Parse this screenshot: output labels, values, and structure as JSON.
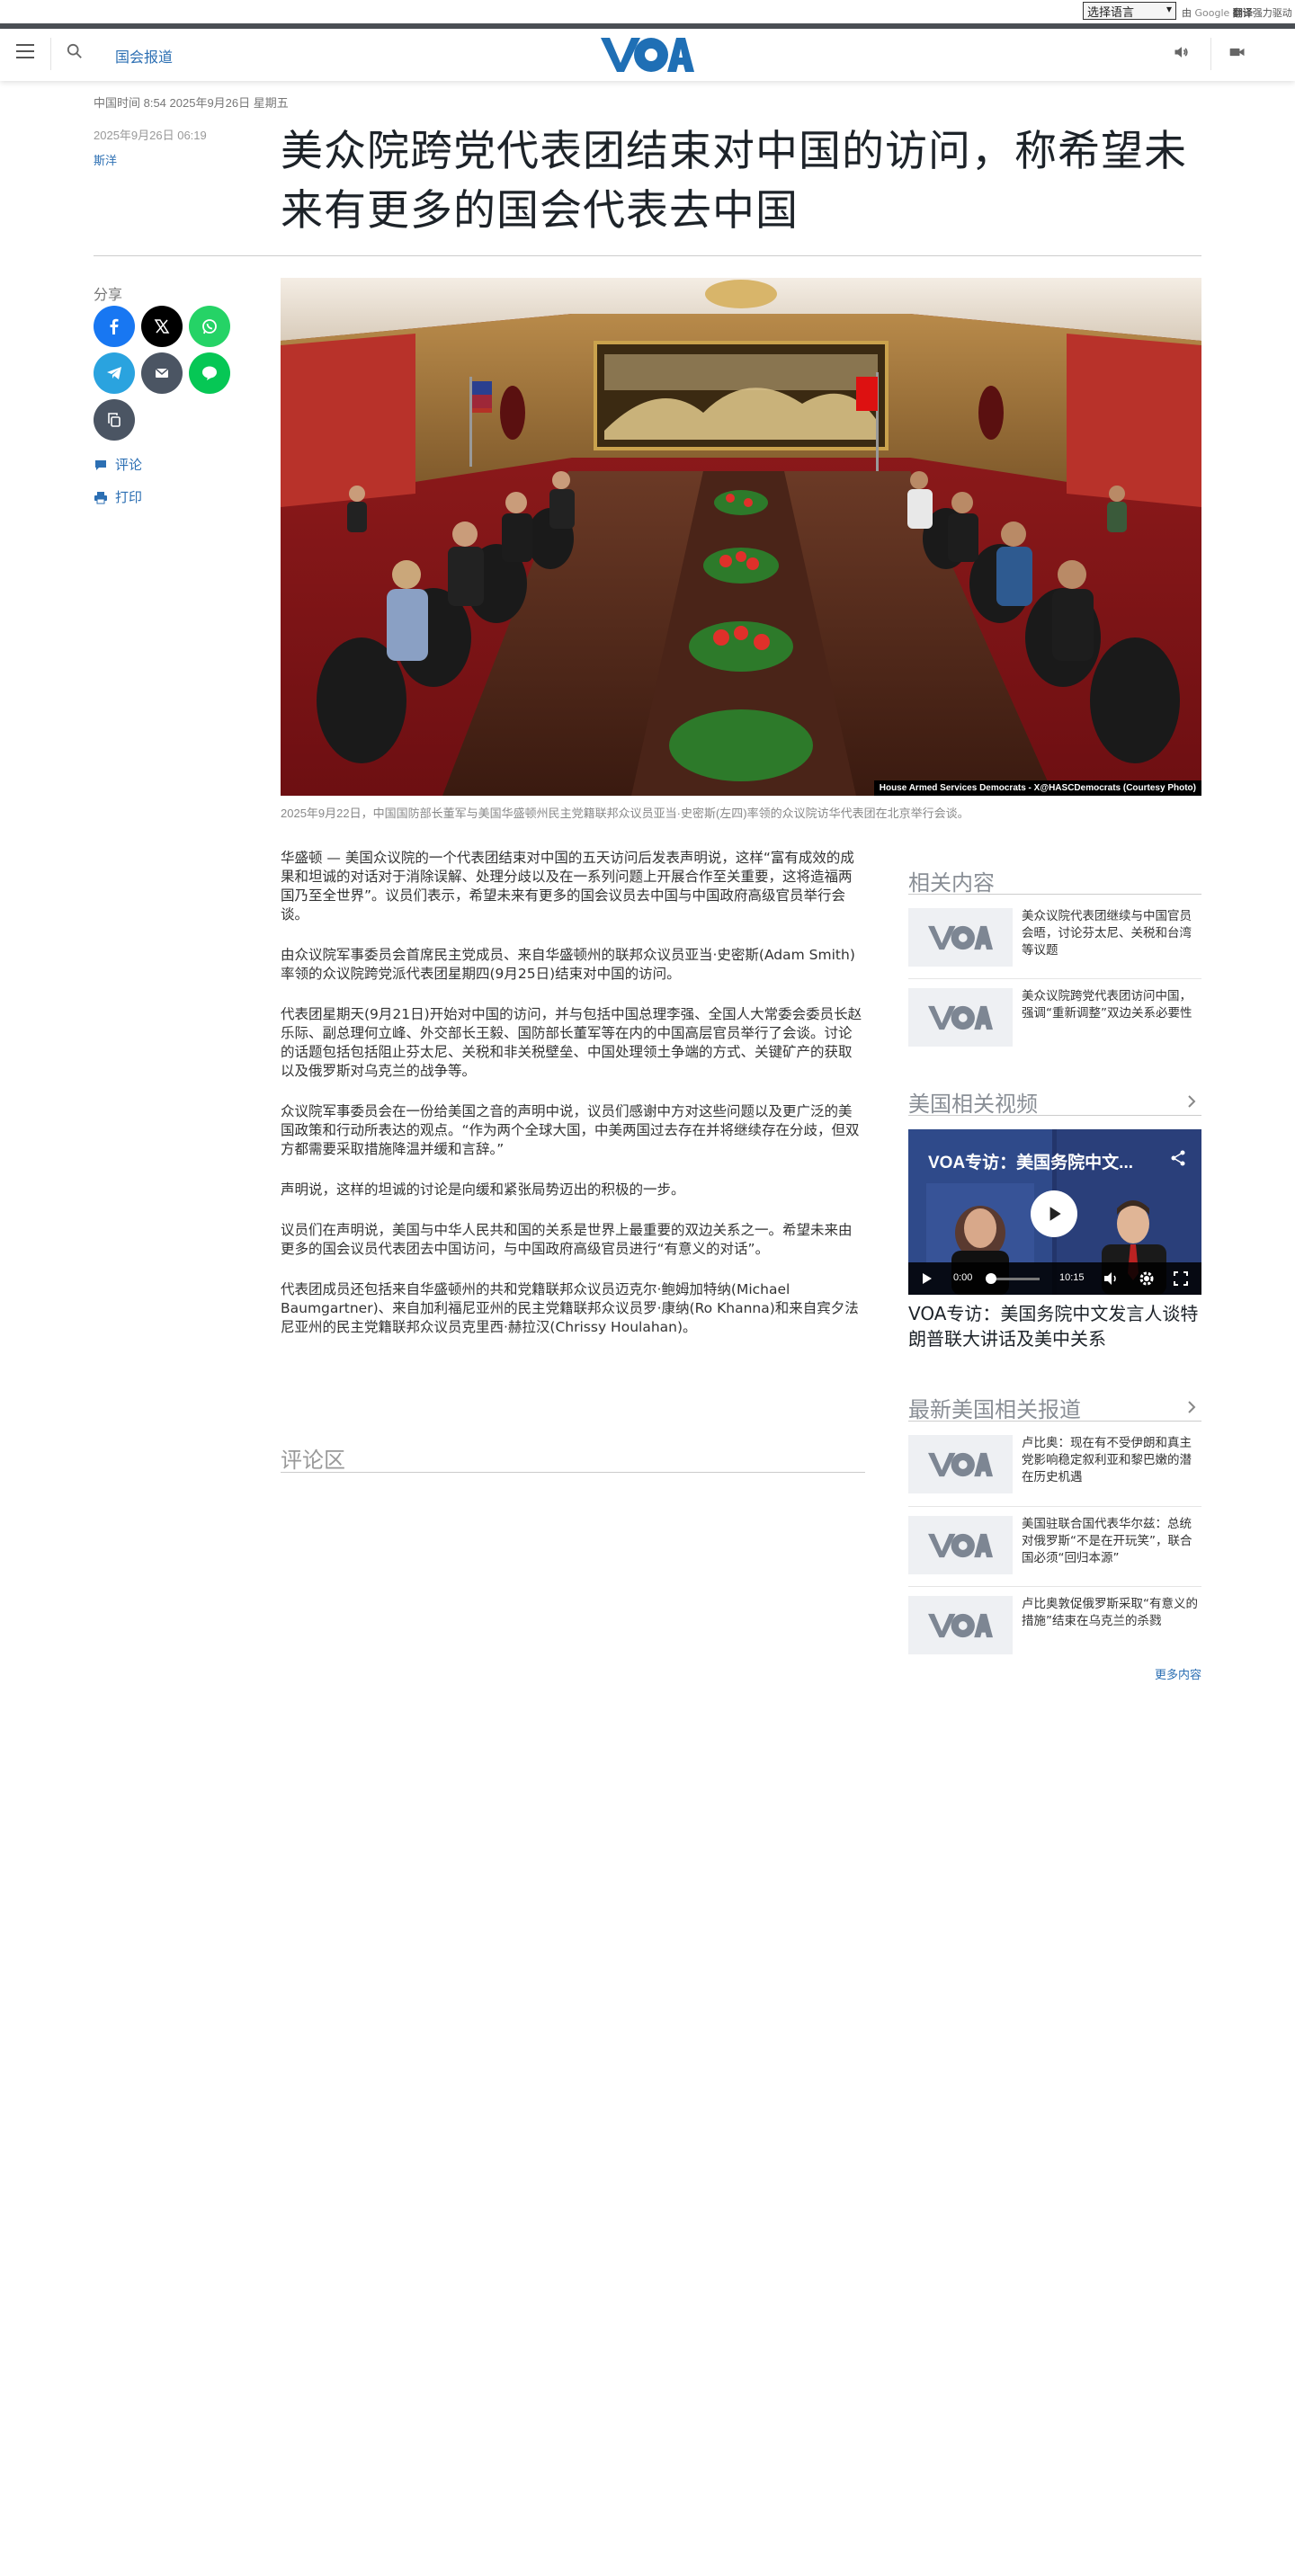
{
  "translate_bar": {
    "select_value": "选择语言",
    "credit_by": "由",
    "credit_google": "Google",
    "credit_translate": "翻译",
    "credit_suffix": "强力驱动"
  },
  "header": {
    "section_link": "国会报道",
    "logo_alt": "VOA",
    "icons": [
      "menu-icon",
      "search-icon",
      "speaker-icon",
      "video-camera-icon"
    ]
  },
  "dateline": "中国时间 8:54 2025年9月26日 星期五",
  "meta": {
    "date": "2025年9月26日 06:19",
    "author": "斯洋"
  },
  "headline": "美众院跨党代表团结束对中国的访问，称希望未来有更多的国会代表去中国",
  "share": {
    "label": "分享",
    "buttons": [
      {
        "name": "facebook",
        "color": "#1877f2"
      },
      {
        "name": "x",
        "color": "#000000"
      },
      {
        "name": "whatsapp",
        "color": "#25d366"
      },
      {
        "name": "telegram",
        "color": "#2aa3df"
      },
      {
        "name": "email",
        "color": "#4b5563"
      },
      {
        "name": "line",
        "color": "#06c755"
      },
      {
        "name": "copy-link",
        "color": "#4b5563"
      }
    ],
    "comment_label": "评论",
    "print_label": "打印"
  },
  "photo": {
    "credit": "House Armed Services Democrats - X@HASCDemocrats (Courtesy Photo)",
    "caption": "2025年9月22日，中国国防部长董军与美国华盛顿州民主党籍联邦众议员亚当·史密斯(左四)率领的众议院访华代表团在北京举行会谈。"
  },
  "article": {
    "paragraphs": [
      "华盛顿 — 美国众议院的一个代表团结束对中国的五天访问后发表声明说，这样“富有成效的成果和坦诚的对话对于消除误解、处理分歧以及在一系列问题上开展合作至关重要，这将造福两国乃至全世界”。议员们表示，希望未来有更多的国会议员去中国与中国政府高级官员举行会谈。",
      "由众议院军事委员会首席民主党成员、来自华盛顿州的联邦众议员亚当·史密斯(Adam Smith)率领的众议院跨党派代表团星期四(9月25日)结束对中国的访问。",
      "代表团星期天(9月21日)开始对中国的访问，并与包括中国总理李强、全国人大常委会委员长赵乐际、副总理何立峰、外交部长王毅、国防部长董军等在内的中国高层官员举行了会谈。讨论的话题包括包括阻止芬太尼、关税和非关税壁垒、中国处理领土争端的方式、关键矿产的获取以及俄罗斯对乌克兰的战争等。",
      "众议院军事委员会在一份给美国之音的声明中说，议员们感谢中方对这些问题以及更广泛的美国政策和行动所表达的观点。“作为两个全球大国，中美两国过去存在并将继续存在分歧，但双方都需要采取措施降温并缓和言辞。”",
      "声明说，这样的坦诚的讨论是向缓和紧张局势迈出的积极的一步。",
      "议员们在声明说，美国与中华人民共和国的关系是世界上最重要的双边关系之一。希望未来由更多的国会议员代表团去中国访问，与中国政府高级官员进行“有意义的对话”。",
      "代表团成员还包括来自华盛顿州的共和党籍联邦众议员迈克尔·鲍姆加特纳(Michael Baumgartner)、来自加利福尼亚州的民主党籍联邦众议员罗·康纳(Ro Khanna)和来自宾夕法尼亚州的民主党籍联邦众议员克里西·赫拉汉(Chrissy Houlahan)。"
    ],
    "comments_title": "评论区"
  },
  "sidebar": {
    "related": {
      "title": "相关内容",
      "items": [
        "美众议院代表团继续与中国官员会晤，讨论芬太尼、关税和台湾等议题",
        "美众议院跨党代表团访问中国，强调“重新调整”双边关系必要性"
      ]
    },
    "videos": {
      "title": "美国相关视频",
      "player_title": "VOA专访：美国务院中文...",
      "time_current": "0:00",
      "time_total": "10:15",
      "progress_fraction": 0.0,
      "headline": "VOA专访：美国务院中文发言人谈特朗普联大讲话及美中关系"
    },
    "latest": {
      "title": "最新美国相关报道",
      "items": [
        "卢比奥：现在有不受伊朗和真主党影响稳定叙利亚和黎巴嫩的潜在历史机遇",
        "美国驻联合国代表华尔兹：总统对俄罗斯“不是在开玩笑”，联合国必须“回归本源”",
        "卢比奥敦促俄罗斯采取“有意义的措施”结束在乌克兰的杀戮"
      ],
      "more_label": "更多内容"
    }
  }
}
